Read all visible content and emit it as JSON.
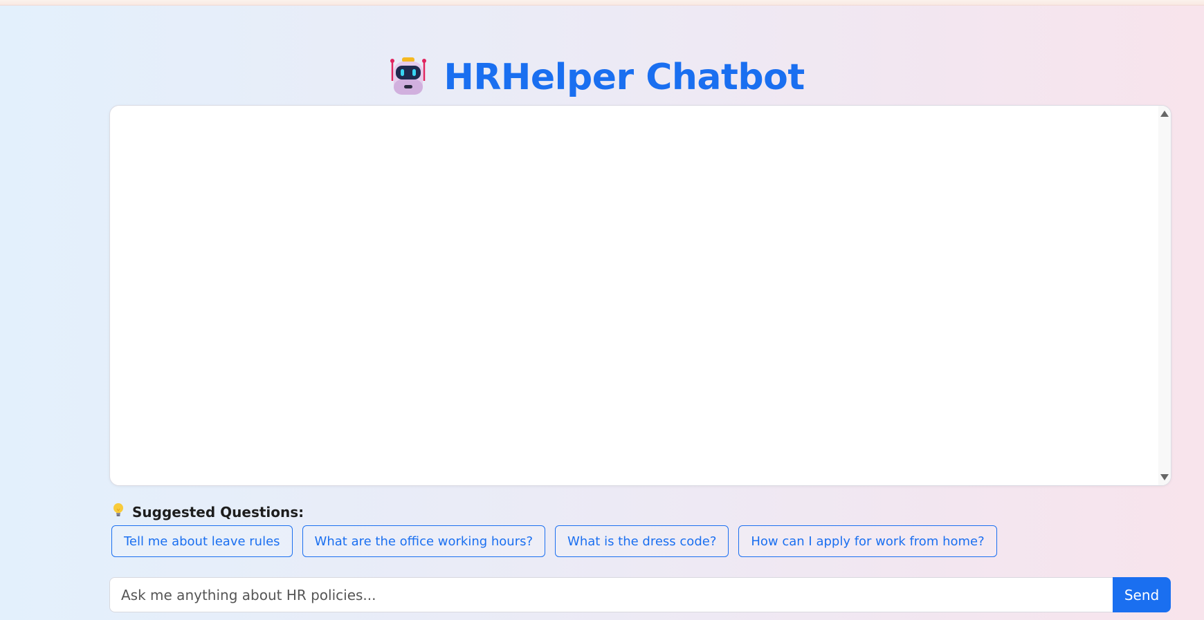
{
  "header": {
    "title": "HRHelper Chatbot",
    "icon": "robot-icon"
  },
  "chat": {
    "messages": []
  },
  "suggested": {
    "icon": "lightbulb-icon",
    "title": "Suggested Questions:",
    "questions": [
      "Tell me about leave rules",
      "What are the office working hours?",
      "What is the dress code?",
      "How can I apply for work from home?"
    ]
  },
  "input": {
    "placeholder": "Ask me anything about HR policies...",
    "value": "",
    "send_label": "Send"
  },
  "colors": {
    "accent": "#1a6ff0"
  }
}
